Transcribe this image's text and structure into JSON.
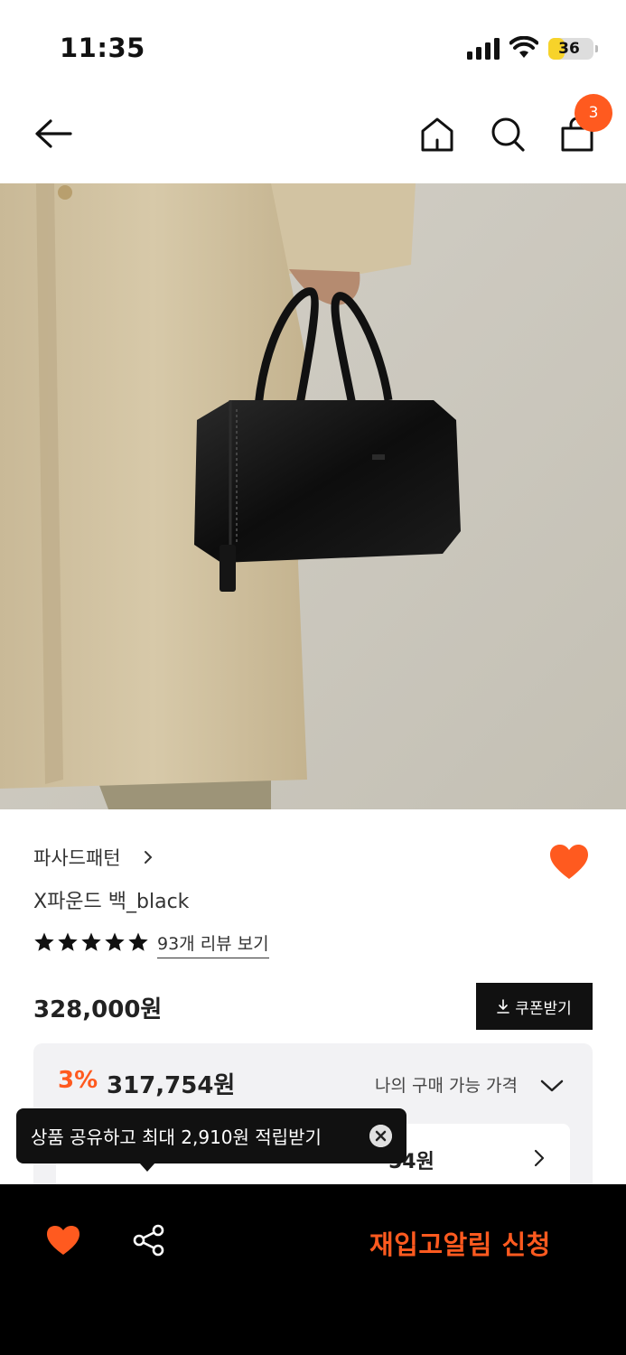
{
  "status_bar": {
    "time": "11:35",
    "battery": "36",
    "battery_level": 0.36
  },
  "header": {
    "cart_count": "3"
  },
  "product": {
    "brand": "파사드패턴",
    "name": "X파운드 백_black",
    "rating_stars": 5,
    "reviews_link": "93개 리뷰 보기",
    "price": "328,000원",
    "coupon_button": "쿠폰받기",
    "discount_percent": "3%",
    "discounted_price": "317,754원",
    "my_price_label": "나의 구매 가능 가격",
    "inner_amount": "54원"
  },
  "tooltip": {
    "text": "상품 공유하고 최대 2,910원 적립받기"
  },
  "bottom_bar": {
    "cta_label": "재입고알림 신청"
  },
  "colors": {
    "accent": "#ff5a1f",
    "dark": "#111111",
    "price_box_bg": "#f2f2f4"
  }
}
